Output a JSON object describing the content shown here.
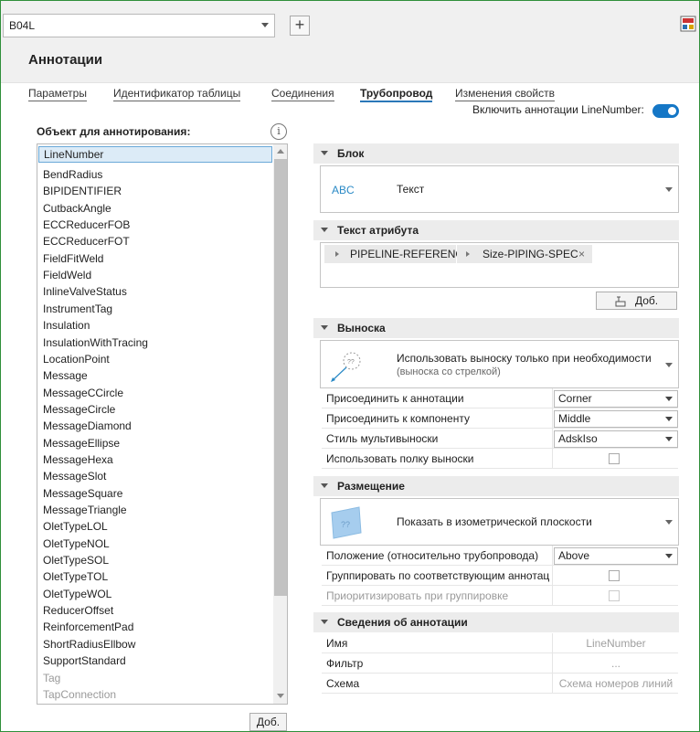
{
  "header": {
    "combo_value": "B04L",
    "add_button": "+",
    "title": "Аннотации"
  },
  "tabs": [
    "Параметры",
    "Идентификатор таблицы",
    "Соединения",
    "Трубопровод",
    "Изменения свойств"
  ],
  "active_tab": "Трубопровод",
  "toggle": {
    "label": "Включить аннотации LineNumber:",
    "on": true
  },
  "left": {
    "title": "Объект для аннотирования:",
    "selected": "LineNumber",
    "items": [
      "BendRadius",
      "BIPIDENTIFIER",
      "CutbackAngle",
      "ECCReducerFOB",
      "ECCReducerFOT",
      "FieldFitWeld",
      "FieldWeld",
      "InlineValveStatus",
      "InstrumentTag",
      "Insulation",
      "InsulationWithTracing",
      "LocationPoint",
      "Message",
      "MessageCCircle",
      "MessageCircle",
      "MessageDiamond",
      "MessageEllipse",
      "MessageHexa",
      "MessageSlot",
      "MessageSquare",
      "MessageTriangle",
      "OletTypeLOL",
      "OletTypeNOL",
      "OletTypeSOL",
      "OletTypeTOL",
      "OletTypeWOL",
      "ReducerOffset",
      "ReinforcementPad",
      "ShortRadiusEllbow",
      "SupportStandard"
    ],
    "disabled_items": [
      "Tag",
      "TapConnection"
    ],
    "add_button": "Доб."
  },
  "block": {
    "header": "Блок",
    "icon_text": "ABC",
    "value": "Текст"
  },
  "attr": {
    "header": "Текст атрибута",
    "chip1": "PIPELINE-REFERENCE-",
    "chip2": "Size-PIPING-SPEC",
    "chip_close": "×",
    "add_button": "Доб."
  },
  "leader": {
    "header": "Выноска",
    "main": "Использовать выноску только при необходимости",
    "sub": "(выноска со стрелкой)",
    "rows": [
      {
        "label": "Присоединить к аннотации",
        "value": "Corner"
      },
      {
        "label": "Присоединить к компоненту",
        "value": "Middle"
      },
      {
        "label": "Стиль мультивыноски",
        "value": "AdskIso"
      }
    ],
    "shelf_label": "Использовать полку выноски",
    "shelf_checked": false
  },
  "placement": {
    "header": "Размещение",
    "main": "Показать в изометрической плоскости",
    "position_label": "Положение (относительно трубопровода)",
    "position_value": "Above",
    "group_label": "Группировать по соответствующим аннотац",
    "group_checked": false,
    "prioritize_label": "Приоритизировать при группировке",
    "prioritize_checked": false
  },
  "info": {
    "header": "Сведения об аннотации",
    "rows": [
      {
        "label": "Имя",
        "value": "LineNumber"
      },
      {
        "label": "Фильтр",
        "value": "..."
      },
      {
        "label": "Схема",
        "value": "Схема номеров линий"
      }
    ]
  },
  "colors": {
    "accent": "#1577c6",
    "selection": "#dcebf7",
    "header_bg": "#ececec"
  },
  "icons": [
    "dropdown-arrow-icon",
    "plus-icon",
    "help-icon",
    "info-icon",
    "collapse-triangle-icon",
    "chip-arrow-icon",
    "close-icon",
    "add-field-icon",
    "leader-icon",
    "plane-icon",
    "checkbox-icon"
  ]
}
